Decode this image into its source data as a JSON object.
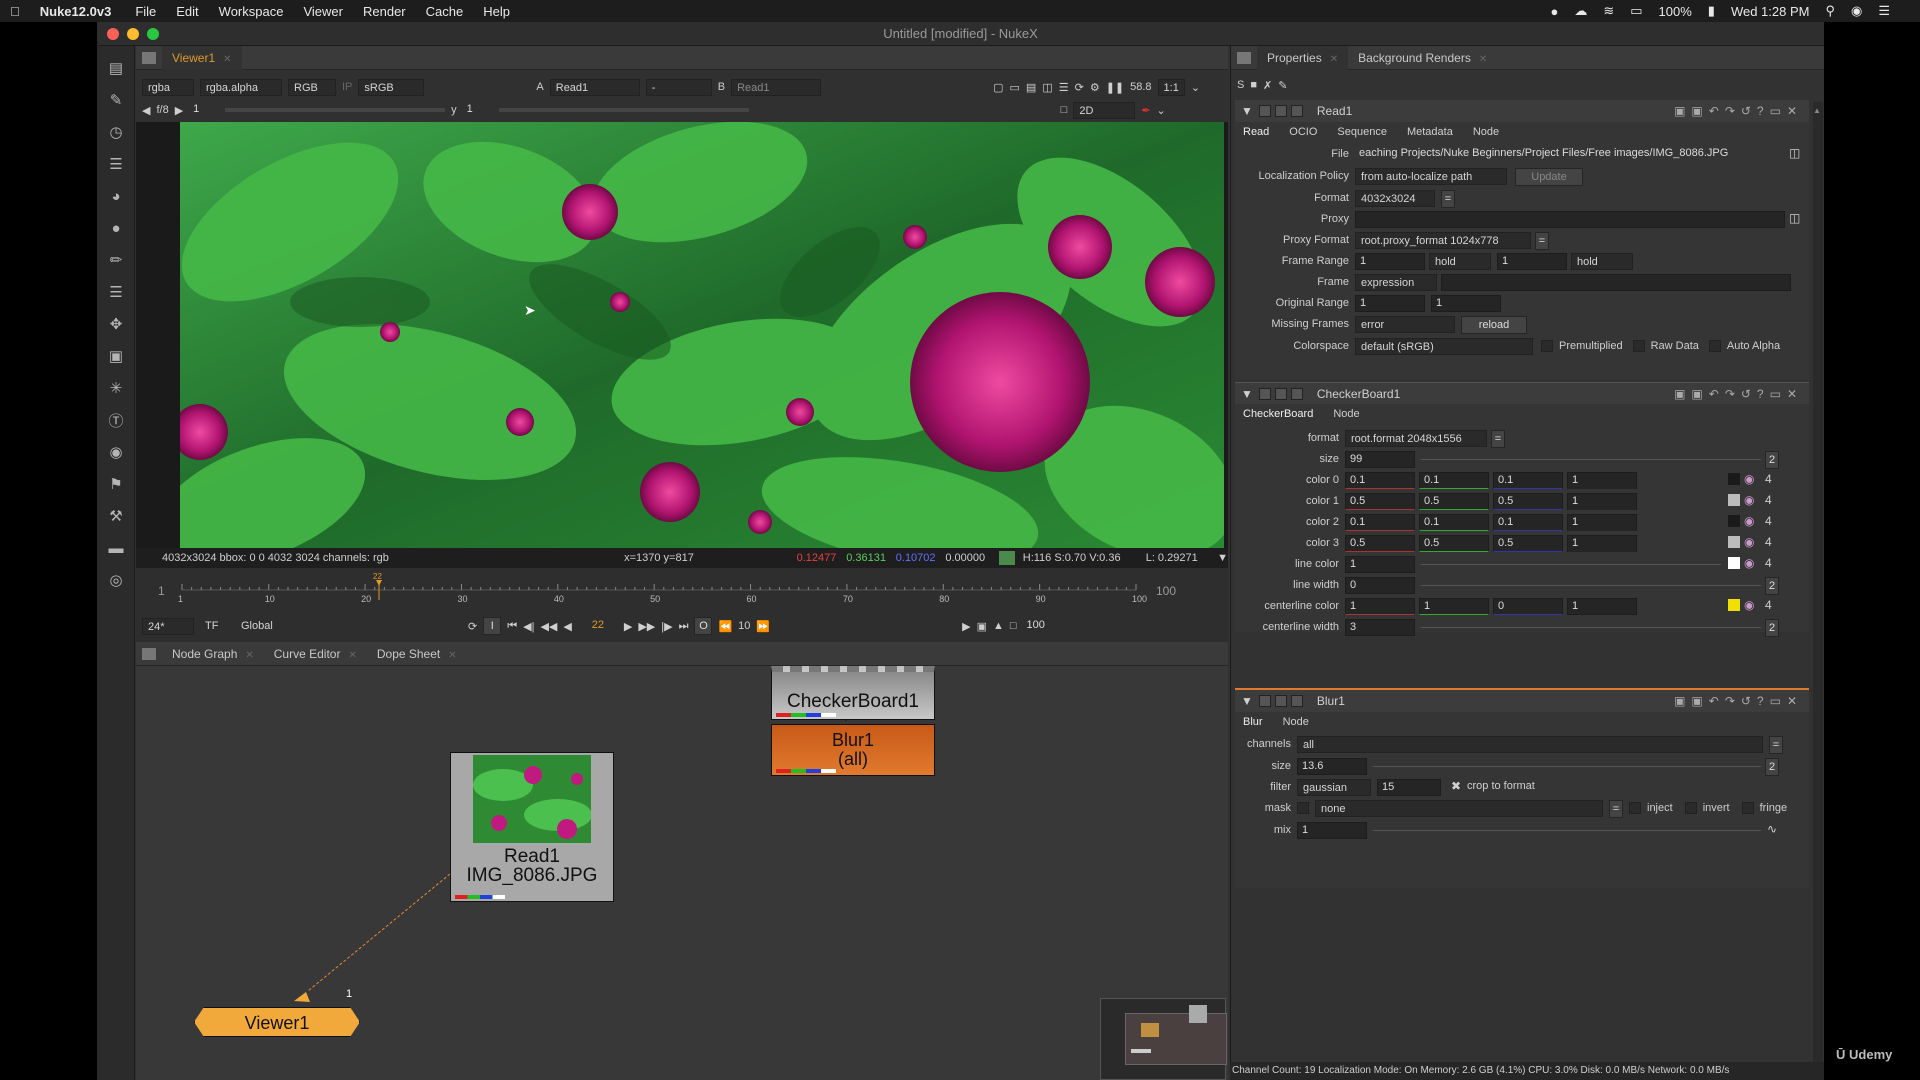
{
  "menubar": {
    "app": "Nuke12.0v3",
    "items": [
      "File",
      "Edit",
      "Workspace",
      "Viewer",
      "Render",
      "Cache",
      "Help"
    ],
    "battery": "100%",
    "clock": "Wed 1:28 PM"
  },
  "window": {
    "title": "Untitled [modified] - NukeX"
  },
  "viewer": {
    "tab": "Viewer1",
    "channels": "rgba",
    "alpha": "rgba.alpha",
    "rgb": "RGB",
    "ip": "IP",
    "lut": "sRGB",
    "a_label": "A",
    "a_input": "Read1",
    "op": "-",
    "b_label": "B",
    "b_input": "Read1",
    "zoom": "58.8",
    "ratio": "1:1",
    "fstop": "f/8",
    "gain": "1",
    "gamma_label": "y",
    "gamma": "1",
    "view_mode": "2D",
    "info_left": "4032x3024   bbox: 0 0 4032 3024 channels: rgb",
    "info_xy": "x=1370 y=817",
    "info_r": "0.12477",
    "info_g": "0.36131",
    "info_b": "0.10702",
    "info_a": "0.00000",
    "info_hsv": "H:116 S:0.70 V:0.36",
    "info_l": "L: 0.29271"
  },
  "timeline": {
    "start": "1",
    "end": "100",
    "current": "22",
    "ticks": [
      "1",
      "10",
      "20",
      "30",
      "40",
      "50",
      "60",
      "70",
      "80",
      "90",
      "100"
    ],
    "fps": "24*",
    "tf": "TF",
    "scope": "Global",
    "in": "I",
    "out": "O",
    "frame": "22",
    "step": "10",
    "end_field": "100"
  },
  "nodegraph": {
    "tabs": [
      "Node Graph",
      "Curve Editor",
      "Dope Sheet"
    ],
    "nodes": {
      "checker": "CheckerBoard1",
      "blur": "Blur1",
      "blur_sub": "(all)",
      "read": "Read1",
      "read_sub": "IMG_8086.JPG",
      "viewer": "Viewer1",
      "viewer_input": "1"
    }
  },
  "properties": {
    "tabs": [
      "Properties",
      "Background Renders"
    ],
    "read": {
      "name": "Read1",
      "tabs": [
        "Read",
        "OCIO",
        "Sequence",
        "Metadata",
        "Node"
      ],
      "file_label": "File",
      "file": "eaching Projects/Nuke Beginners/Project Files/Free images/IMG_8086.JPG",
      "loc_label": "Localization Policy",
      "loc": "from auto-localize path",
      "update": "Update",
      "format_label": "Format",
      "format": "4032x3024",
      "proxy_label": "Proxy",
      "proxy_format_label": "Proxy Format",
      "proxy_format": "root.proxy_format 1024x778",
      "frame_range_label": "Frame Range",
      "fr_start": "1",
      "fr_before": "hold",
      "fr_end": "1",
      "fr_after": "hold",
      "frame_label": "Frame",
      "frame_mode": "expression",
      "orig_label": "Original Range",
      "orig_start": "1",
      "orig_end": "1",
      "missing_label": "Missing Frames",
      "missing": "error",
      "reload": "reload",
      "colorspace_label": "Colorspace",
      "colorspace": "default (sRGB)",
      "premult": "Premultiplied",
      "raw": "Raw Data",
      "auto_alpha": "Auto Alpha"
    },
    "checker": {
      "name": "CheckerBoard1",
      "tabs": [
        "CheckerBoard",
        "Node"
      ],
      "format_label": "format",
      "format": "root.format 2048x1556",
      "size_label": "size",
      "size": "99",
      "rows": [
        {
          "label": "color 0",
          "v": [
            "0.1",
            "0.1",
            "0.1",
            "1"
          ],
          "swatch": "#1a1a1a"
        },
        {
          "label": "color 1",
          "v": [
            "0.5",
            "0.5",
            "0.5",
            "1"
          ],
          "swatch": "#bcbcbc"
        },
        {
          "label": "color 2",
          "v": [
            "0.1",
            "0.1",
            "0.1",
            "1"
          ],
          "swatch": "#1a1a1a"
        },
        {
          "label": "color 3",
          "v": [
            "0.5",
            "0.5",
            "0.5",
            "1"
          ],
          "swatch": "#bcbcbc"
        }
      ],
      "line_color_label": "line color",
      "line_color": "1",
      "line_width_label": "line width",
      "line_width": "0",
      "centerline_color_label": "centerline color",
      "cl": [
        "1",
        "1",
        "0",
        "1"
      ],
      "centerline_width_label": "centerline width",
      "centerline_width": "3",
      "two": "2",
      "four": "4"
    },
    "blur": {
      "name": "Blur1",
      "tabs": [
        "Blur",
        "Node"
      ],
      "channels_label": "channels",
      "channels": "all",
      "size_label": "size",
      "size": "13.6",
      "filter_label": "filter",
      "filter": "gaussian",
      "quality": "15",
      "crop": "crop to format",
      "mask_label": "mask",
      "mask": "none",
      "inject": "inject",
      "invert": "invert",
      "fringe": "fringe",
      "mix_label": "mix",
      "mix": "1",
      "two": "2"
    }
  },
  "statusbar": {
    "text": "Channel Count: 19  Localization Mode: On  Memory: 2.6 GB (4.1%)  CPU: 3.0%  Disk: 0.0 MB/s  Network: 0.0 MB/s"
  },
  "watermark": {
    "text": "Udemy"
  },
  "colors": {
    "accent": "#e09a2a",
    "blur_node": "#e07a2e",
    "viewer_node": "#f2a93b",
    "checker_node": "#b0b0b0",
    "read_node": "#9a9a9a"
  }
}
